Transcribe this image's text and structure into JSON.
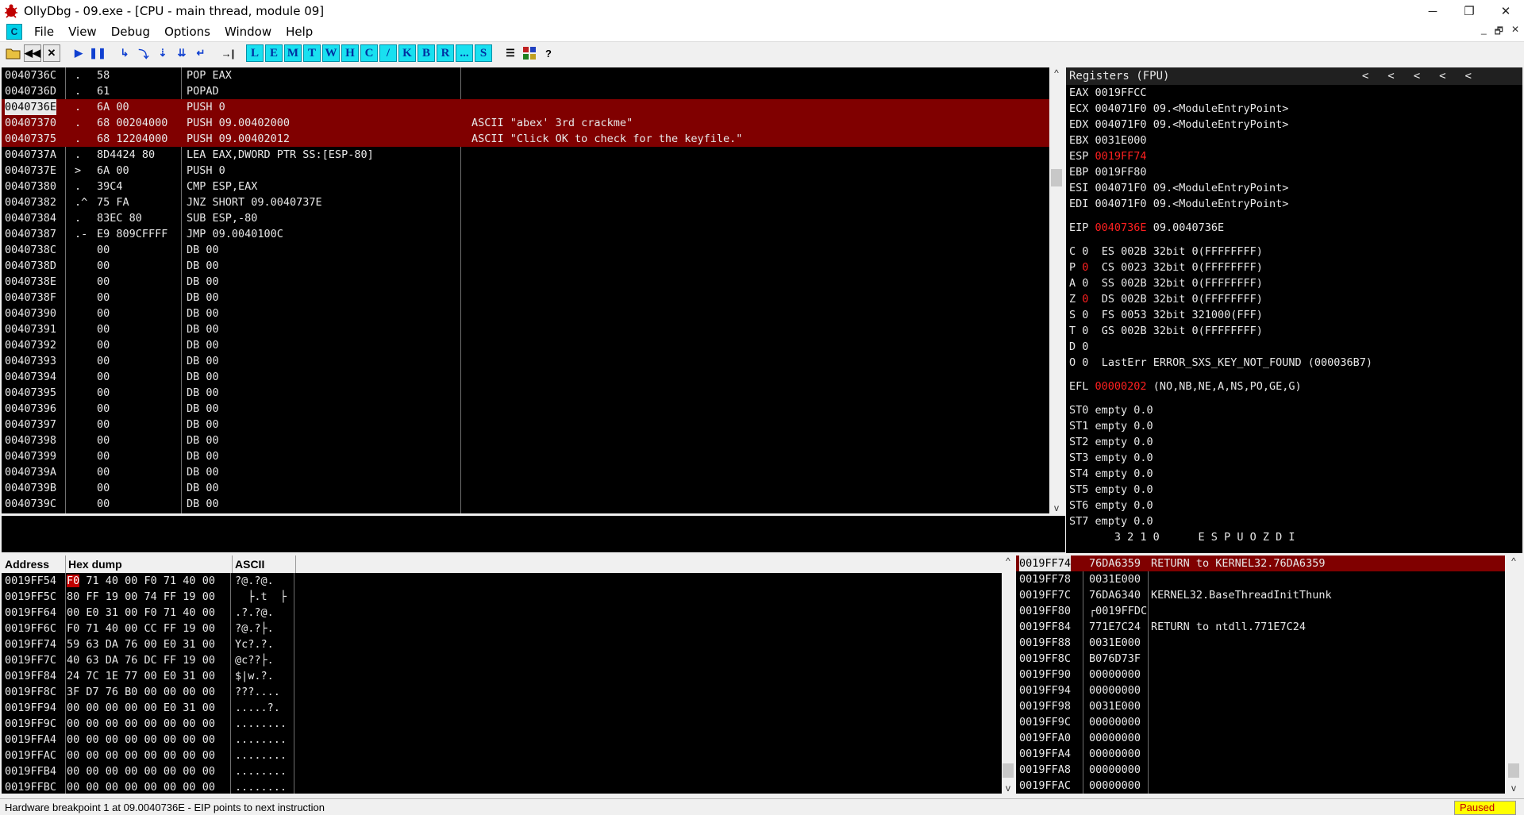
{
  "window": {
    "title": "OllyDbg - 09.exe - [CPU - main thread, module 09]",
    "minimize": "─",
    "restore": "❐",
    "close": "✕"
  },
  "menu": {
    "mdi_icon": "C",
    "items": [
      "File",
      "View",
      "Debug",
      "Options",
      "Window",
      "Help"
    ],
    "mdi_controls": [
      "_",
      "🗗",
      "✕"
    ]
  },
  "toolbar": {
    "left_buttons": [
      "open-icon",
      "rewind-icon",
      "close-icon",
      "run-icon",
      "pause-icon",
      "step-into-icon",
      "step-over-icon",
      "trace-into-icon",
      "trace-over-icon",
      "execute-till-return-icon",
      "goto-icon"
    ],
    "letter_buttons": [
      "L",
      "E",
      "M",
      "T",
      "W",
      "H",
      "C",
      "/",
      "K",
      "B",
      "R",
      "...",
      "S"
    ],
    "right_buttons": [
      "list-icon",
      "grid-icon",
      "help-icon"
    ],
    "help_label": "?"
  },
  "disasm": {
    "rows": [
      {
        "addr": "0040736C",
        "mark": ".",
        "hex": "58",
        "ins": "POP EAX",
        "comment": ""
      },
      {
        "addr": "0040736D",
        "mark": ".",
        "hex": "61",
        "ins": "POPAD",
        "comment": ""
      },
      {
        "addr": "0040736E",
        "mark": ".",
        "hex": "6A 00",
        "ins": "PUSH 0",
        "comment": ""
      },
      {
        "addr": "00407370",
        "mark": ".",
        "hex": "68 00204000",
        "ins": "PUSH 09.00402000",
        "comment": "ASCII \"abex' 3rd crackme\""
      },
      {
        "addr": "00407375",
        "mark": ".",
        "hex": "68 12204000",
        "ins": "PUSH 09.00402012",
        "comment": "ASCII \"Click OK to check for the keyfile.\""
      },
      {
        "addr": "0040737A",
        "mark": ".",
        "hex": "8D4424 80",
        "ins": "LEA EAX,DWORD PTR SS:[ESP-80]",
        "comment": ""
      },
      {
        "addr": "0040737E",
        "mark": ">",
        "hex": "6A 00",
        "ins": "PUSH 0",
        "comment": ""
      },
      {
        "addr": "00407380",
        "mark": ".",
        "hex": "39C4",
        "ins": "CMP ESP,EAX",
        "comment": ""
      },
      {
        "addr": "00407382",
        "mark": ".^",
        "hex": "75 FA",
        "ins": "JNZ SHORT 09.0040737E",
        "comment": ""
      },
      {
        "addr": "00407384",
        "mark": ".",
        "hex": "83EC 80",
        "ins": "SUB ESP,-80",
        "comment": ""
      },
      {
        "addr": "00407387",
        "mark": ".-",
        "hex": "E9 809CFFFF",
        "ins": "JMP 09.0040100C",
        "comment": ""
      },
      {
        "addr": "0040738C",
        "mark": "",
        "hex": "00",
        "ins": "DB 00",
        "comment": ""
      },
      {
        "addr": "0040738D",
        "mark": "",
        "hex": "00",
        "ins": "DB 00",
        "comment": ""
      },
      {
        "addr": "0040738E",
        "mark": "",
        "hex": "00",
        "ins": "DB 00",
        "comment": ""
      },
      {
        "addr": "0040738F",
        "mark": "",
        "hex": "00",
        "ins": "DB 00",
        "comment": ""
      },
      {
        "addr": "00407390",
        "mark": "",
        "hex": "00",
        "ins": "DB 00",
        "comment": ""
      },
      {
        "addr": "00407391",
        "mark": "",
        "hex": "00",
        "ins": "DB 00",
        "comment": ""
      },
      {
        "addr": "00407392",
        "mark": "",
        "hex": "00",
        "ins": "DB 00",
        "comment": ""
      },
      {
        "addr": "00407393",
        "mark": "",
        "hex": "00",
        "ins": "DB 00",
        "comment": ""
      },
      {
        "addr": "00407394",
        "mark": "",
        "hex": "00",
        "ins": "DB 00",
        "comment": ""
      },
      {
        "addr": "00407395",
        "mark": "",
        "hex": "00",
        "ins": "DB 00",
        "comment": ""
      },
      {
        "addr": "00407396",
        "mark": "",
        "hex": "00",
        "ins": "DB 00",
        "comment": ""
      },
      {
        "addr": "00407397",
        "mark": "",
        "hex": "00",
        "ins": "DB 00",
        "comment": ""
      },
      {
        "addr": "00407398",
        "mark": "",
        "hex": "00",
        "ins": "DB 00",
        "comment": ""
      },
      {
        "addr": "00407399",
        "mark": "",
        "hex": "00",
        "ins": "DB 00",
        "comment": ""
      },
      {
        "addr": "0040739A",
        "mark": "",
        "hex": "00",
        "ins": "DB 00",
        "comment": ""
      },
      {
        "addr": "0040739B",
        "mark": "",
        "hex": "00",
        "ins": "DB 00",
        "comment": ""
      },
      {
        "addr": "0040739C",
        "mark": "",
        "hex": "00",
        "ins": "DB 00",
        "comment": ""
      }
    ],
    "selected_rows": [
      2,
      3,
      4
    ],
    "eip_row": 2
  },
  "registers": {
    "header": "Registers (FPU)",
    "arrows": "<<<<<",
    "gp": [
      {
        "name": "EAX",
        "value": "0019FFCC",
        "info": "",
        "changed": false
      },
      {
        "name": "ECX",
        "value": "004071F0",
        "info": "09.<ModuleEntryPoint>",
        "changed": false
      },
      {
        "name": "EDX",
        "value": "004071F0",
        "info": "09.<ModuleEntryPoint>",
        "changed": false
      },
      {
        "name": "EBX",
        "value": "0031E000",
        "info": "",
        "changed": false
      },
      {
        "name": "ESP",
        "value": "0019FF74",
        "info": "",
        "changed": true
      },
      {
        "name": "EBP",
        "value": "0019FF80",
        "info": "",
        "changed": false
      },
      {
        "name": "ESI",
        "value": "004071F0",
        "info": "09.<ModuleEntryPoint>",
        "changed": false
      },
      {
        "name": "EDI",
        "value": "004071F0",
        "info": "09.<ModuleEntryPoint>",
        "changed": false
      }
    ],
    "eip": {
      "name": "EIP",
      "value": "0040736E",
      "info": "09.0040736E"
    },
    "flags": [
      {
        "flag": "C",
        "val": "0",
        "changed": false,
        "seg": "ES 002B 32bit 0(FFFFFFFF)"
      },
      {
        "flag": "P",
        "val": "0",
        "changed": true,
        "seg": "CS 0023 32bit 0(FFFFFFFF)"
      },
      {
        "flag": "A",
        "val": "0",
        "changed": false,
        "seg": "SS 002B 32bit 0(FFFFFFFF)"
      },
      {
        "flag": "Z",
        "val": "0",
        "changed": true,
        "seg": "DS 002B 32bit 0(FFFFFFFF)"
      },
      {
        "flag": "S",
        "val": "0",
        "changed": false,
        "seg": "FS 0053 32bit 321000(FFF)"
      },
      {
        "flag": "T",
        "val": "0",
        "changed": false,
        "seg": "GS 002B 32bit 0(FFFFFFFF)"
      },
      {
        "flag": "D",
        "val": "0",
        "changed": false,
        "seg": ""
      },
      {
        "flag": "O",
        "val": "0",
        "changed": false,
        "seg": "LastErr ERROR_SXS_KEY_NOT_FOUND (000036B7)"
      }
    ],
    "efl": {
      "name": "EFL",
      "value": "00000202",
      "info": "(NO,NB,NE,A,NS,PO,GE,G)"
    },
    "fpu": [
      {
        "name": "ST0",
        "value": "empty 0.0"
      },
      {
        "name": "ST1",
        "value": "empty 0.0"
      },
      {
        "name": "ST2",
        "value": "empty 0.0"
      },
      {
        "name": "ST3",
        "value": "empty 0.0"
      },
      {
        "name": "ST4",
        "value": "empty 0.0"
      },
      {
        "name": "ST5",
        "value": "empty 0.0"
      },
      {
        "name": "ST6",
        "value": "empty 0.0"
      },
      {
        "name": "ST7",
        "value": "empty 0.0"
      }
    ],
    "fpu_footer": "       3 2 1 0      E S P U O Z D I"
  },
  "dump": {
    "headers": [
      "Address",
      "Hex dump",
      "ASCII"
    ],
    "rows": [
      {
        "addr": "0019FF54",
        "first": "F0",
        "hex": " 71 40 00 F0 71 40 00",
        "ascii": "?@.?@."
      },
      {
        "addr": "0019FF5C",
        "first": "80",
        "hex": " FF 19 00 74 FF 19 00",
        "ascii": "  ├.t  ├"
      },
      {
        "addr": "0019FF64",
        "first": "00",
        "hex": " E0 31 00 F0 71 40 00",
        "ascii": ".?.?@."
      },
      {
        "addr": "0019FF6C",
        "first": "F0",
        "hex": " 71 40 00 CC FF 19 00",
        "ascii": "?@.?├."
      },
      {
        "addr": "0019FF74",
        "first": "59",
        "hex": " 63 DA 76 00 E0 31 00",
        "ascii": "Yc?.?."
      },
      {
        "addr": "0019FF7C",
        "first": "40",
        "hex": " 63 DA 76 DC FF 19 00",
        "ascii": "@c??├."
      },
      {
        "addr": "0019FF84",
        "first": "24",
        "hex": " 7C 1E 77 00 E0 31 00",
        "ascii": "$|w.?."
      },
      {
        "addr": "0019FF8C",
        "first": "3F",
        "hex": " D7 76 B0 00 00 00 00",
        "ascii": "???...."
      },
      {
        "addr": "0019FF94",
        "first": "00",
        "hex": " 00 00 00 00 E0 31 00",
        "ascii": ".....?."
      },
      {
        "addr": "0019FF9C",
        "first": "00",
        "hex": " 00 00 00 00 00 00 00",
        "ascii": "........"
      },
      {
        "addr": "0019FFA4",
        "first": "00",
        "hex": " 00 00 00 00 00 00 00",
        "ascii": "........"
      },
      {
        "addr": "0019FFAC",
        "first": "00",
        "hex": " 00 00 00 00 00 00 00",
        "ascii": "........"
      },
      {
        "addr": "0019FFB4",
        "first": "00",
        "hex": " 00 00 00 00 00 00 00",
        "ascii": "........"
      },
      {
        "addr": "0019FFBC",
        "first": "00",
        "hex": " 00 00 00 00 00 00 00",
        "ascii": "........"
      }
    ]
  },
  "stack": {
    "rows": [
      {
        "addr": "0019FF74",
        "value": "76DA6359",
        "comment": "RETURN to KERNEL32.76DA6359"
      },
      {
        "addr": "0019FF78",
        "value": "0031E000",
        "comment": ""
      },
      {
        "addr": "0019FF7C",
        "value": "76DA6340",
        "comment": "KERNEL32.BaseThreadInitThunk"
      },
      {
        "addr": "0019FF80",
        "value": "┌0019FFDC",
        "comment": ""
      },
      {
        "addr": "0019FF84",
        "value": "771E7C24",
        "comment": "RETURN to ntdll.771E7C24"
      },
      {
        "addr": "0019FF88",
        "value": "0031E000",
        "comment": ""
      },
      {
        "addr": "0019FF8C",
        "value": "B076D73F",
        "comment": ""
      },
      {
        "addr": "0019FF90",
        "value": "00000000",
        "comment": ""
      },
      {
        "addr": "0019FF94",
        "value": "00000000",
        "comment": ""
      },
      {
        "addr": "0019FF98",
        "value": "0031E000",
        "comment": ""
      },
      {
        "addr": "0019FF9C",
        "value": "00000000",
        "comment": ""
      },
      {
        "addr": "0019FFA0",
        "value": "00000000",
        "comment": ""
      },
      {
        "addr": "0019FFA4",
        "value": "00000000",
        "comment": ""
      },
      {
        "addr": "0019FFA8",
        "value": "00000000",
        "comment": ""
      },
      {
        "addr": "0019FFAC",
        "value": "00000000",
        "comment": ""
      }
    ]
  },
  "status": {
    "message": "Hardware breakpoint 1 at 09.0040736E - EIP points to next instruction",
    "state": "Paused"
  },
  "colors": {
    "selection": "#800000",
    "changed": "#ff2020",
    "pane_bg": "#000000",
    "paused_bg": "#ffff00"
  }
}
